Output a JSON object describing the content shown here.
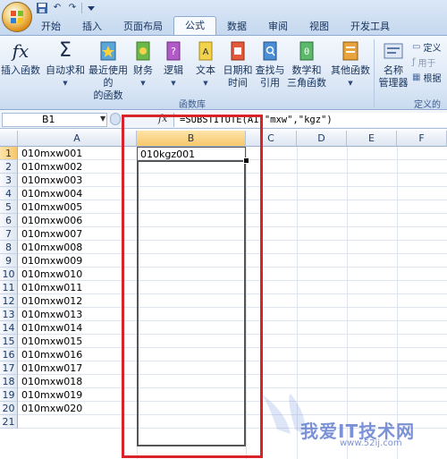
{
  "qat": {
    "undo": "↶",
    "redo": "↷"
  },
  "tabs": [
    "开始",
    "插入",
    "页面布局",
    "公式",
    "数据",
    "审阅",
    "视图",
    "开发工具"
  ],
  "active_tab": "公式",
  "ribbon": {
    "insert_function": "插入函数",
    "autosum": {
      "line1": "自动求和"
    },
    "recent": {
      "line1": "最近使用的",
      "line2": "的函数"
    },
    "financial": {
      "line1": "财务"
    },
    "logical": {
      "line1": "逻辑"
    },
    "text": {
      "line1": "文本"
    },
    "datetime": {
      "line1": "日期和",
      "line2": "时间"
    },
    "lookup": {
      "line1": "查找与",
      "line2": "引用"
    },
    "math": {
      "line1": "数学和",
      "line2": "三角函数"
    },
    "other": {
      "line1": "其他函数"
    },
    "group_label": "函数库",
    "name_manager": {
      "line1": "名称",
      "line2": "管理器"
    },
    "define_name": "定义",
    "use_in_formula": "用于",
    "create_from_sel": "根据",
    "group_label2": "定义的"
  },
  "formula_bar": {
    "name_box": "B1",
    "fx": "fx",
    "formula": "=SUBSTITUTE(A1,\"mxw\",\"kgz\")"
  },
  "columns": [
    "A",
    "B",
    "C",
    "D",
    "E",
    "F"
  ],
  "rows": [
    "1",
    "2",
    "3",
    "4",
    "5",
    "6",
    "7",
    "8",
    "9",
    "10",
    "11",
    "12",
    "13",
    "14",
    "15",
    "16",
    "17",
    "18",
    "19",
    "20",
    "21"
  ],
  "col_a": [
    "010mxw001",
    "010mxw002",
    "010mxw003",
    "010mxw004",
    "010mxw005",
    "010mxw006",
    "010mxw007",
    "010mxw008",
    "010mxw009",
    "010mxw010",
    "010mxw011",
    "010mxw012",
    "010mxw013",
    "010mxw014",
    "010mxw015",
    "010mxw016",
    "010mxw017",
    "010mxw018",
    "010mxw019",
    "010mxw020"
  ],
  "b1_value": "010kgz001",
  "watermark": {
    "text": "我爱IT技术网",
    "url": "www.52ij.com"
  },
  "colors": {
    "highlight_red": "#d8232a",
    "selected_header": "#f7c76b"
  }
}
